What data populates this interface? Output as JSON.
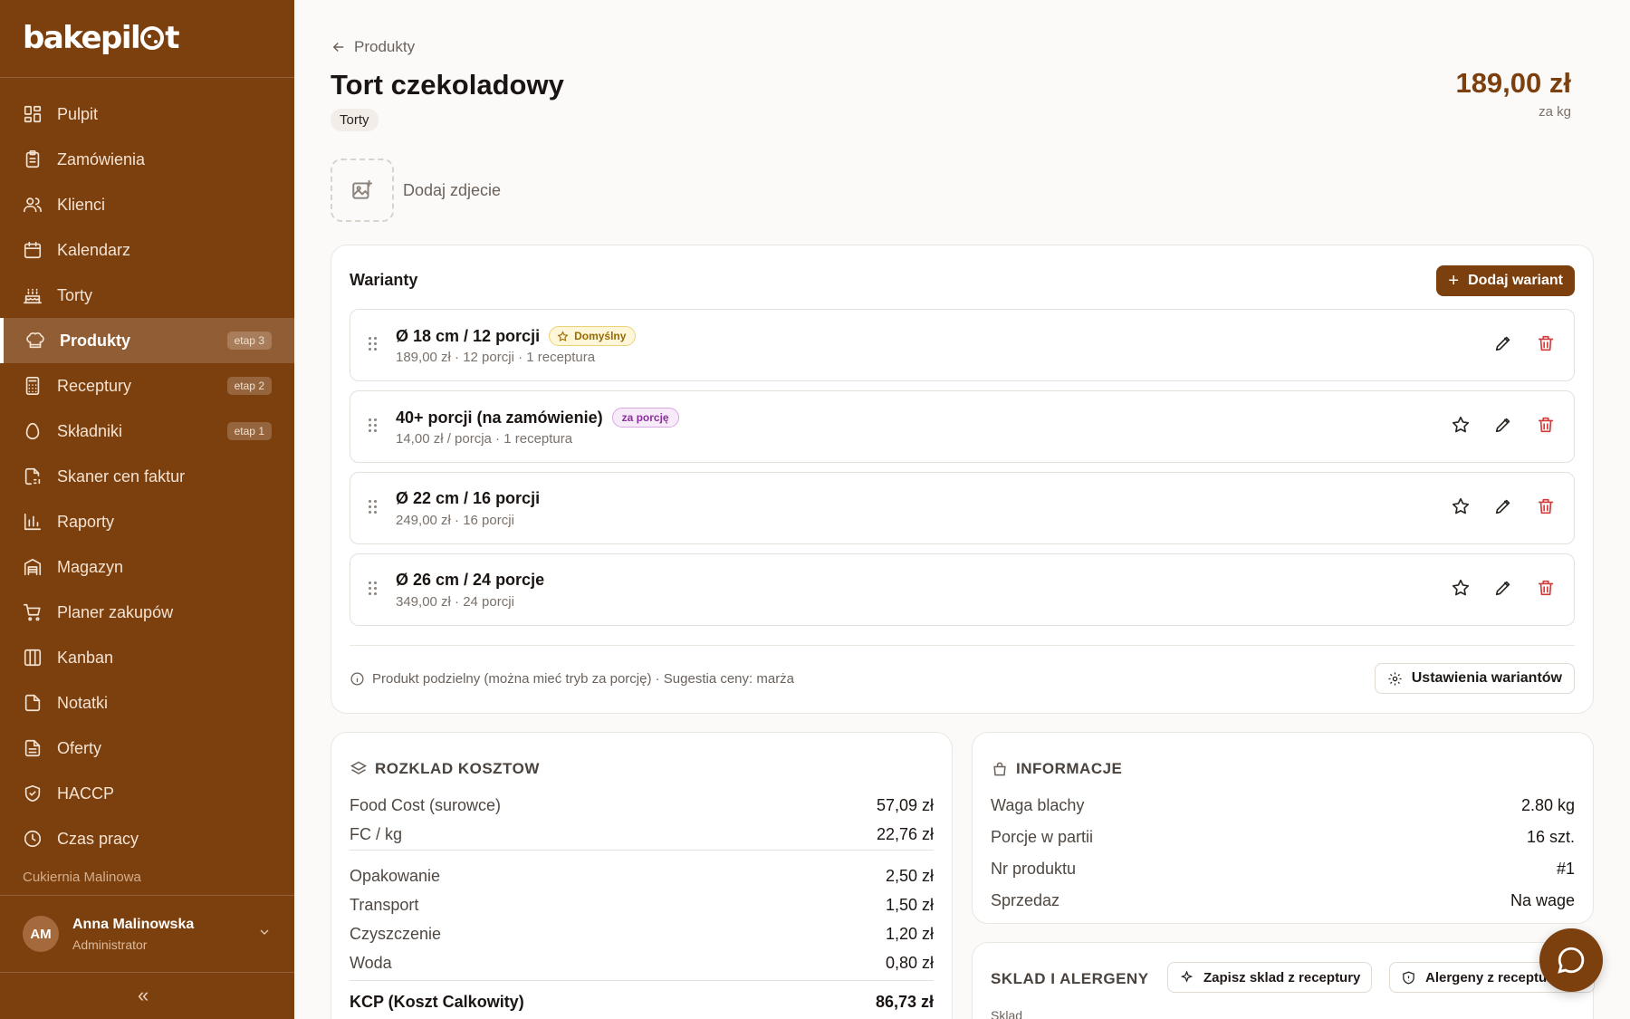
{
  "brand": {
    "logo_text_a": "bakepil",
    "logo_text_b": "t",
    "accent_color": "#7c3f0e"
  },
  "sidebar": {
    "items": [
      {
        "label": "Pulpit",
        "icon": "dashboard-icon",
        "badge": ""
      },
      {
        "label": "Zamówienia",
        "icon": "clipboard-icon",
        "badge": ""
      },
      {
        "label": "Klienci",
        "icon": "users-icon",
        "badge": ""
      },
      {
        "label": "Kalendarz",
        "icon": "calendar-icon",
        "badge": ""
      },
      {
        "label": "Torty",
        "icon": "cake-icon",
        "badge": ""
      },
      {
        "label": "Produkty",
        "icon": "chef-hat-icon",
        "badge": "etap 3",
        "active": true
      },
      {
        "label": "Receptury",
        "icon": "calculator-icon",
        "badge": "etap 2"
      },
      {
        "label": "Składniki",
        "icon": "egg-icon",
        "badge": "etap 1"
      },
      {
        "label": "Skaner cen faktur",
        "icon": "scan-document-icon",
        "badge": ""
      },
      {
        "label": "Raporty",
        "icon": "bar-chart-icon",
        "badge": ""
      },
      {
        "label": "Magazyn",
        "icon": "warehouse-icon",
        "badge": ""
      },
      {
        "label": "Planer zakupów",
        "icon": "cart-icon",
        "badge": ""
      },
      {
        "label": "Kanban",
        "icon": "kanban-icon",
        "badge": ""
      },
      {
        "label": "Notatki",
        "icon": "note-icon",
        "badge": ""
      },
      {
        "label": "Oferty",
        "icon": "document-icon",
        "badge": ""
      },
      {
        "label": "HACCP",
        "icon": "shield-check-icon",
        "badge": ""
      },
      {
        "label": "Czas pracy",
        "icon": "clock-icon",
        "badge": ""
      }
    ],
    "org_name": "Cukiernia Malinowa",
    "user": {
      "initials": "AM",
      "name": "Anna Malinowska",
      "role": "Administrator"
    },
    "collapse_label": "«"
  },
  "header": {
    "back_label": "Produkty",
    "title": "Tort czekoladowy",
    "category": "Torty",
    "price": "189,00 zł",
    "price_unit": "za kg",
    "add_photo_label": "Dodaj zdjecie"
  },
  "variants": {
    "title": "Warianty",
    "add_label": "Dodaj wariant",
    "items": [
      {
        "name": "Ø 18 cm / 12 porcji",
        "badge": "Domyślny",
        "sub": "189,00 zł · 12 porcji · 1 receptura"
      },
      {
        "name": "40+ porcji (na zamówienie)",
        "badge": "za porcję",
        "sub": "14,00 zł / porcja · 1 receptura"
      },
      {
        "name": "Ø 22 cm / 16 porcji",
        "badge": "",
        "sub": "249,00 zł · 16 porcji"
      },
      {
        "name": "Ø 26 cm / 24 porcje",
        "badge": "",
        "sub": "349,00 zł · 24 porcji"
      }
    ],
    "info_text": "Produkt podzielny (można mieć tryb za porcję) · Sugestia ceny: marża",
    "settings_label": "Ustawienia wariantów"
  },
  "costs": {
    "title": "ROZKLAD KOSZTOW",
    "rows": [
      {
        "label": "Food Cost (surowce)",
        "value": "57,09 zł"
      },
      {
        "label": "FC / kg",
        "value": "22,76 zł"
      },
      {
        "label": "Opakowanie",
        "value": "2,50 zł"
      },
      {
        "label": "Transport",
        "value": "1,50 zł"
      },
      {
        "label": "Czyszczenie",
        "value": "1,20 zł"
      },
      {
        "label": "Woda",
        "value": "0,80 zł"
      }
    ],
    "total": {
      "label": "KCP (Koszt Calkowity)",
      "value": "86,73 zł"
    }
  },
  "info": {
    "title": "INFORMACJE",
    "rows": [
      {
        "label": "Waga blachy",
        "value": "2.80 kg"
      },
      {
        "label": "Porcje w partii",
        "value": "16 szt."
      },
      {
        "label": "Nr produktu",
        "value": "#1"
      },
      {
        "label": "Sprzedaz",
        "value": "Na wage"
      }
    ]
  },
  "sklad": {
    "title": "SKLAD I ALERGENY",
    "save_label": "Zapisz sklad z receptury",
    "allergens_label": "Alergeny z receptury",
    "field_label": "Sklad"
  }
}
